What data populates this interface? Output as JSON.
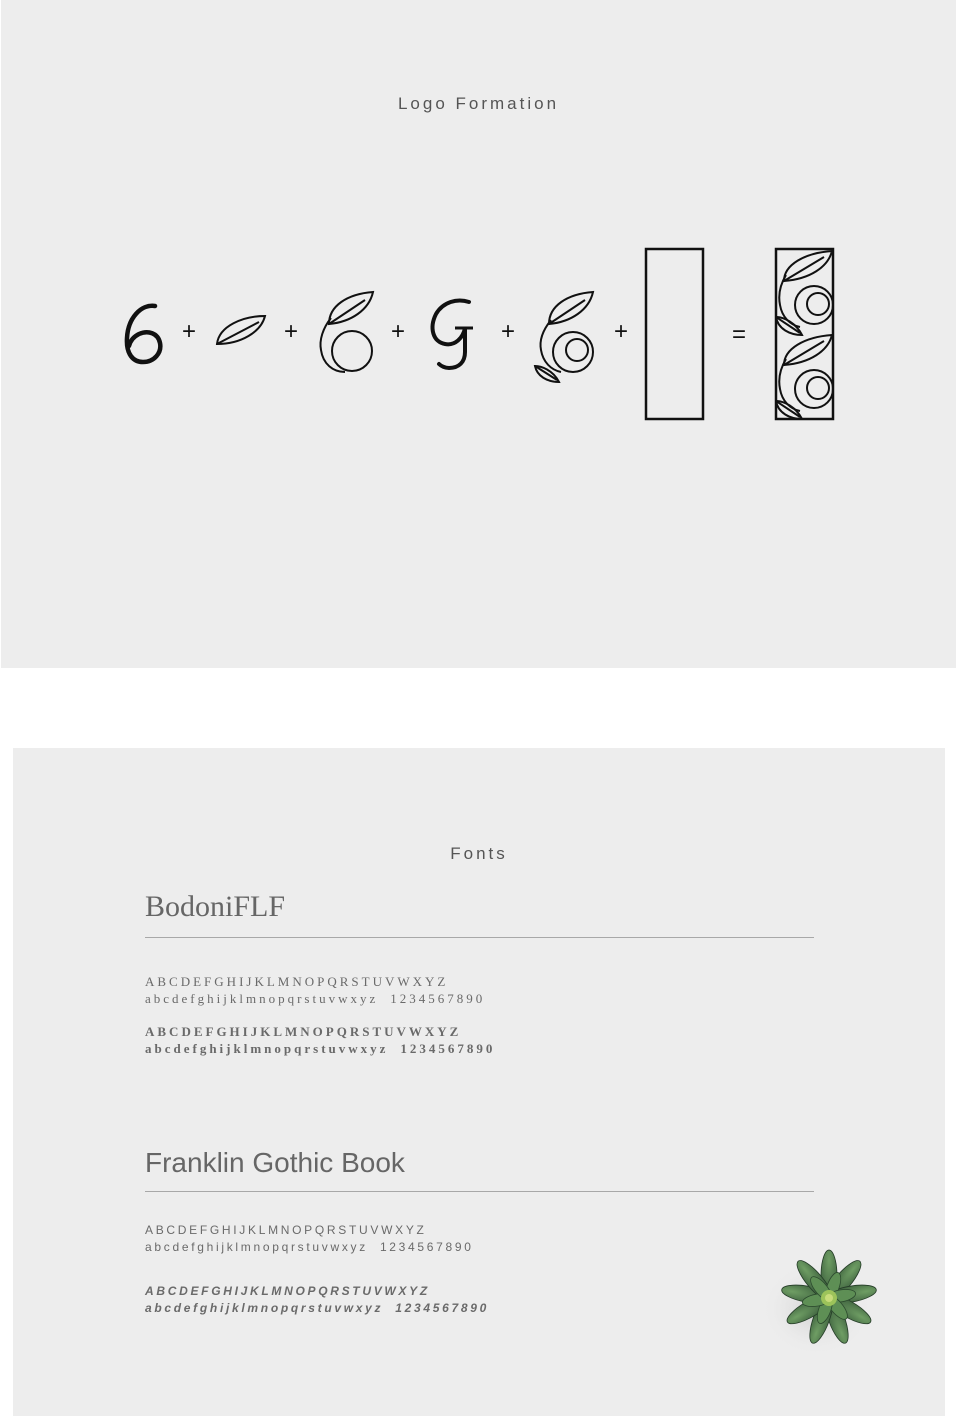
{
  "logo_section": {
    "title": "Logo Formation",
    "steps": [
      {
        "name": "numeral-six",
        "operator": "+"
      },
      {
        "name": "leaf",
        "operator": "+"
      },
      {
        "name": "leaf-circle",
        "operator": "+"
      },
      {
        "name": "letter-g",
        "operator": "+"
      },
      {
        "name": "leaf-circle-g",
        "operator": "+"
      },
      {
        "name": "rectangle-frame",
        "operator": "="
      },
      {
        "name": "final-logo",
        "operator": ""
      }
    ],
    "stroke_color": "#111111"
  },
  "fonts_section": {
    "title": "Fonts",
    "font1": {
      "name": "BodoniFLF",
      "regular_upper": "ABCDEFGHIJKLMNOPQRSTUVWXYZ",
      "regular_lower": "abcdefghijklmnopqrstuvwxyz",
      "regular_digits": "1234567890",
      "bold_upper": "ABCDEFGHIJKLMNOPQRSTUVWXYZ",
      "bold_lower": "abcdefghijklmnopqrstuvwxyz",
      "bold_digits": "1234567890"
    },
    "font2": {
      "name": "Franklin Gothic Book",
      "regular_upper": "ABCDEFGHIJKLMNOPQRSTUVWXYZ",
      "regular_lower": "abcdefghijklmnopqrstuvwxyz",
      "regular_digits": "1234567890",
      "bold_italic_upper": "ABCDEFGHIJKLMNOPQRSTUVWXYZ",
      "bold_italic_lower": "abcdefghijklmnopqrstuvwxyz",
      "bold_italic_digits": "1234567890"
    }
  },
  "colors": {
    "panel_background": "#ededed",
    "page_background": "#ffffff",
    "text_gray": "#6a6a6a",
    "rule_gray": "#a8a8a8"
  }
}
